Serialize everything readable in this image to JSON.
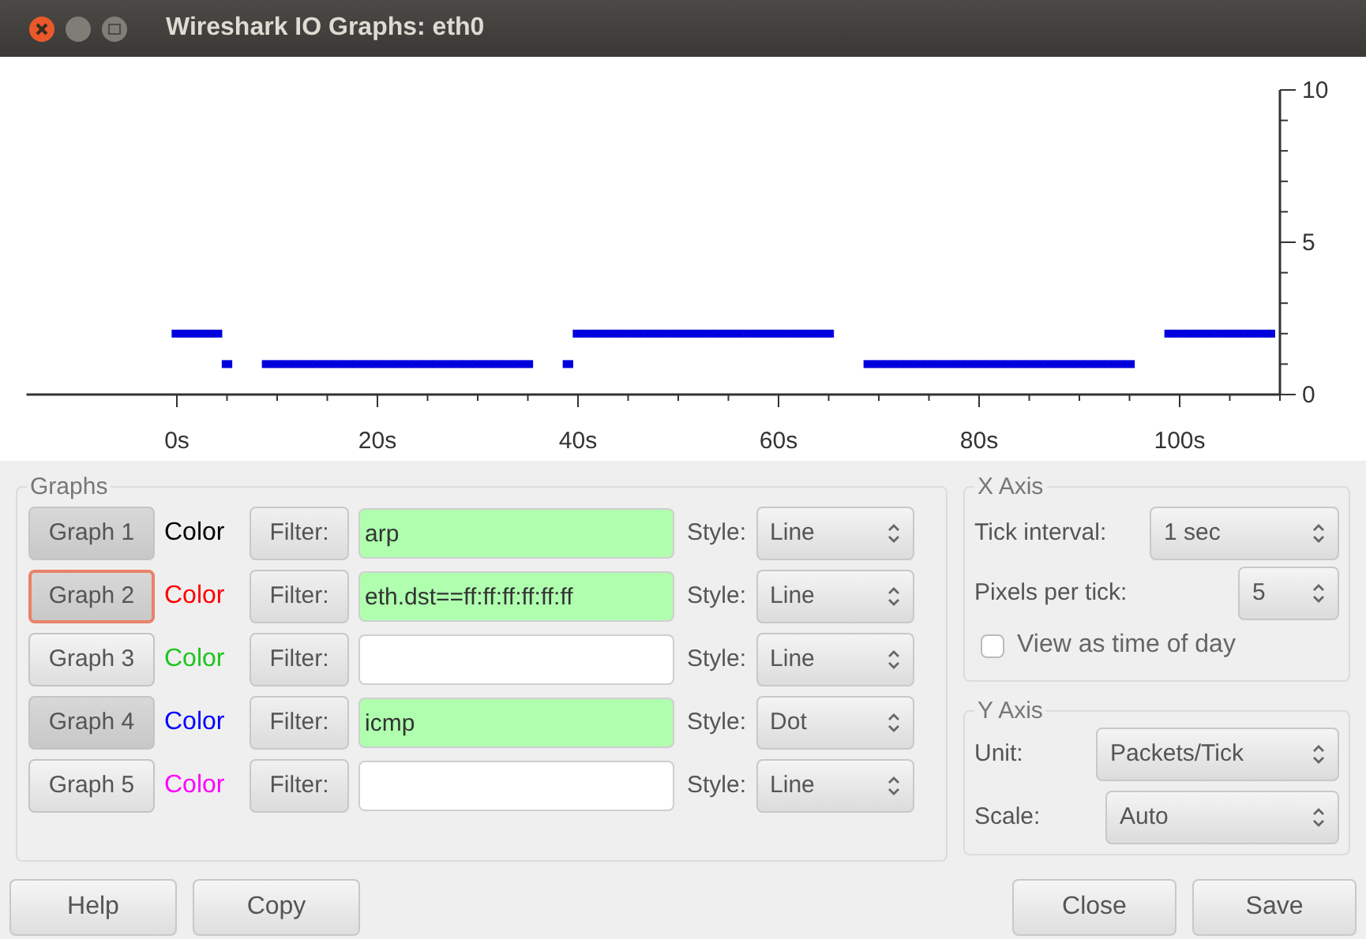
{
  "window": {
    "title": "Wireshark IO Graphs: eth0"
  },
  "chart": {
    "chart_data": {
      "type": "scatter",
      "xlim": [
        -15,
        110
      ],
      "ylim": [
        0,
        10
      ],
      "xticks": [
        {
          "value": 0,
          "label": "0s"
        },
        {
          "value": 20,
          "label": "20s"
        },
        {
          "value": 40,
          "label": "40s"
        },
        {
          "value": 60,
          "label": "60s"
        },
        {
          "value": 80,
          "label": "80s"
        },
        {
          "value": 100,
          "label": "100s"
        }
      ],
      "yticks": [
        0,
        5,
        10
      ],
      "x": [
        0,
        1,
        2,
        3,
        4,
        5,
        9,
        10,
        11,
        12,
        13,
        14,
        15,
        16,
        17,
        18,
        19,
        20,
        21,
        22,
        23,
        24,
        25,
        26,
        27,
        28,
        29,
        30,
        31,
        32,
        33,
        34,
        35,
        39,
        40,
        41,
        42,
        43,
        44,
        45,
        46,
        47,
        48,
        49,
        50,
        51,
        52,
        53,
        54,
        55,
        56,
        57,
        58,
        59,
        60,
        61,
        62,
        63,
        64,
        65,
        69,
        70,
        71,
        72,
        73,
        74,
        75,
        76,
        77,
        78,
        79,
        80,
        81,
        82,
        83,
        84,
        85,
        86,
        87,
        88,
        89,
        90,
        91,
        92,
        93,
        94,
        95,
        99,
        100,
        101,
        102,
        103,
        104,
        105,
        106,
        107,
        108,
        109
      ],
      "series": [
        {
          "color": "#0000dd",
          "values": [
            2,
            2,
            2,
            2,
            2,
            1,
            1,
            1,
            1,
            1,
            1,
            1,
            1,
            1,
            1,
            1,
            1,
            1,
            1,
            1,
            1,
            1,
            1,
            1,
            1,
            1,
            1,
            1,
            1,
            1,
            1,
            1,
            1,
            1,
            2,
            2,
            2,
            2,
            2,
            2,
            2,
            2,
            2,
            2,
            2,
            2,
            2,
            2,
            2,
            2,
            2,
            2,
            2,
            2,
            2,
            2,
            2,
            2,
            2,
            2,
            1,
            1,
            1,
            1,
            1,
            1,
            1,
            1,
            1,
            1,
            1,
            1,
            1,
            1,
            1,
            1,
            1,
            1,
            1,
            1,
            1,
            1,
            1,
            1,
            1,
            1,
            1,
            2,
            2,
            2,
            2,
            2,
            2,
            2,
            2,
            2,
            2,
            2
          ]
        }
      ]
    }
  },
  "graphs": {
    "title": "Graphs",
    "rows": [
      {
        "button": "Graph 1",
        "on": true,
        "focused": false,
        "color_label": "Color",
        "color": "#000000",
        "filter_button": "Filter:",
        "filter": "arp",
        "valid": true,
        "style_label": "Style:",
        "style": "Line"
      },
      {
        "button": "Graph 2",
        "on": true,
        "focused": true,
        "color_label": "Color",
        "color": "#ff0000",
        "filter_button": "Filter:",
        "filter": "eth.dst==ff:ff:ff:ff:ff:ff",
        "valid": true,
        "style_label": "Style:",
        "style": "Line"
      },
      {
        "button": "Graph 3",
        "on": false,
        "focused": false,
        "color_label": "Color",
        "color": "#1fc41f",
        "filter_button": "Filter:",
        "filter": "",
        "valid": false,
        "style_label": "Style:",
        "style": "Line"
      },
      {
        "button": "Graph 4",
        "on": true,
        "focused": false,
        "color_label": "Color",
        "color": "#0000ff",
        "filter_button": "Filter:",
        "filter": "icmp",
        "valid": true,
        "style_label": "Style:",
        "style": "Dot"
      },
      {
        "button": "Graph 5",
        "on": false,
        "focused": false,
        "color_label": "Color",
        "color": "#ff00ff",
        "filter_button": "Filter:",
        "filter": "",
        "valid": false,
        "style_label": "Style:",
        "style": "Line"
      }
    ]
  },
  "x_axis": {
    "title": "X Axis",
    "tick_interval_label": "Tick interval:",
    "tick_interval": "1 sec",
    "pixels_per_tick_label": "Pixels per tick:",
    "pixels_per_tick": "5",
    "time_of_day_label": "View as time of day",
    "time_of_day_checked": false
  },
  "y_axis": {
    "title": "Y Axis",
    "unit_label": "Unit:",
    "unit": "Packets/Tick",
    "scale_label": "Scale:",
    "scale": "Auto"
  },
  "buttons": [
    "Help",
    "Copy",
    "Close",
    "Save"
  ]
}
